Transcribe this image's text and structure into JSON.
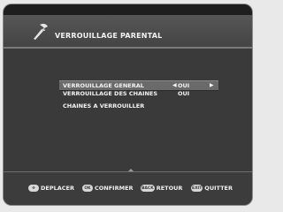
{
  "header": {
    "title": "VERROUILLAGE PARENTAL",
    "icon": "wrench-icon"
  },
  "menu": {
    "items": [
      {
        "label": "VERROUILLAGE GENERAL",
        "value": "OUI",
        "selected": true
      },
      {
        "label": "VERROUILLAGE DES CHAINES",
        "value": "OUI",
        "selected": false
      },
      {
        "label": "CHAINES A VERROUILLER",
        "value": "",
        "selected": false
      }
    ],
    "left_arrow": "◀",
    "right_arrow": "▶"
  },
  "footer": {
    "hints": [
      {
        "key": "✥",
        "label": "DEPLACER",
        "icon": "dpad-icon"
      },
      {
        "key": "OK",
        "label": "CONFIRMER",
        "icon": "ok-key-icon"
      },
      {
        "key": "BACK",
        "label": "RETOUR",
        "icon": "back-key-icon"
      },
      {
        "key": "EXIT",
        "label": "QUITTER",
        "icon": "exit-key-icon"
      }
    ]
  },
  "colors": {
    "background": "#3c3c3c",
    "selected_row": "#6a6a6a",
    "text": "#f4f4f4"
  }
}
